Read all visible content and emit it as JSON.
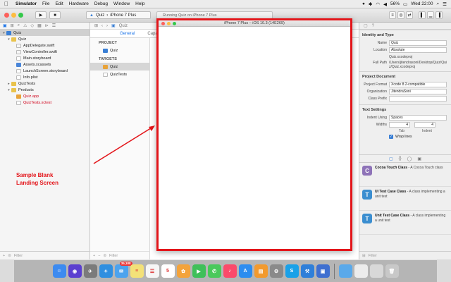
{
  "menubar": {
    "app": "Simulator",
    "items": [
      "File",
      "Edit",
      "Hardware",
      "Debug",
      "Window",
      "Help"
    ],
    "battery": "56%",
    "clock": "Wed 22:00"
  },
  "toolbar": {
    "scheme_target": "Quiz",
    "scheme_device": "iPhone 7 Plus",
    "activity_text": "Running Quiz on iPhone 7 Plus"
  },
  "navigator": {
    "rows": [
      {
        "label": "Quiz",
        "icon": "proj",
        "depth": 0,
        "disclosure": "▾",
        "selected": true,
        "red": false
      },
      {
        "label": "Quiz",
        "icon": "folder",
        "depth": 1,
        "disclosure": "▾",
        "selected": false,
        "red": false
      },
      {
        "label": "AppDelegate.swift",
        "icon": "swift",
        "depth": 2,
        "disclosure": "",
        "selected": false,
        "red": false
      },
      {
        "label": "ViewController.swift",
        "icon": "swift",
        "depth": 2,
        "disclosure": "",
        "selected": false,
        "red": false
      },
      {
        "label": "Main.storyboard",
        "icon": "story",
        "depth": 2,
        "disclosure": "",
        "selected": false,
        "red": false
      },
      {
        "label": "Assets.xcassets",
        "icon": "assets",
        "depth": 2,
        "disclosure": "",
        "selected": false,
        "red": false
      },
      {
        "label": "LaunchScreen.storyboard",
        "icon": "story",
        "depth": 2,
        "disclosure": "",
        "selected": false,
        "red": false
      },
      {
        "label": "Info.plist",
        "icon": "plist",
        "depth": 2,
        "disclosure": "",
        "selected": false,
        "red": false
      },
      {
        "label": "QuizTests",
        "icon": "folder",
        "depth": 1,
        "disclosure": "▸",
        "selected": false,
        "red": false
      },
      {
        "label": "Products",
        "icon": "folder",
        "depth": 1,
        "disclosure": "▾",
        "selected": false,
        "red": false
      },
      {
        "label": "Quiz.app",
        "icon": "app",
        "depth": 2,
        "disclosure": "",
        "selected": false,
        "red": true
      },
      {
        "label": "QuizTests.xctest",
        "icon": "plist",
        "depth": 2,
        "disclosure": "",
        "selected": false,
        "red": true
      }
    ],
    "filter_placeholder": "Filter"
  },
  "editor": {
    "breadcrumb": "Quiz",
    "tabs": [
      "General",
      "Capa"
    ],
    "project_header": "PROJECT",
    "project_item": "Quiz",
    "targets_header": "TARGETS",
    "targets": [
      "Quiz",
      "QuizTests"
    ],
    "filter_placeholder": "Filter"
  },
  "simulator": {
    "title": "iPhone 7 Plus – iOS 10.3 (14E269)"
  },
  "annotation": {
    "text": "Sample Blank Landing Screen"
  },
  "inspector": {
    "identity": {
      "title": "Identity and Type",
      "name_label": "Name",
      "name_value": "Quiz",
      "location_label": "Location",
      "location_value": "Absolute",
      "file_value": "Quiz.xcodeproj",
      "full_path_label": "Full Path",
      "full_path_value": "/Users/jitendrasoni/Desktop/Quiz/Quiz/Quiz.xcodeproj"
    },
    "project_document": {
      "title": "Project Document",
      "format_label": "Project Format",
      "format_value": "Xcode 8.2-compatible",
      "org_label": "Organization",
      "org_value": "JitendraSoni",
      "prefix_label": "Class Prefix",
      "prefix_value": ""
    },
    "text_settings": {
      "title": "Text Settings",
      "indent_label": "Indent Using",
      "indent_value": "Spaces",
      "widths_label": "Widths",
      "tab_value": "4",
      "indent_width_value": "4",
      "tab_caption": "Tab",
      "indent_caption": "Indent",
      "wrap_label": "Wrap lines"
    },
    "library": [
      {
        "title": "Cocoa Touch Class",
        "desc": " - A Cocoa Touch class",
        "icon_letter": "C",
        "color": "#8e73b8"
      },
      {
        "title": "UI Test Case Class",
        "desc": " - A class implementing a unit test",
        "icon_letter": "T",
        "color": "#3b8ed0"
      },
      {
        "title": "Unit Test Case Class",
        "desc": " - A class implementing a unit test",
        "icon_letter": "T",
        "color": "#3b8ed0"
      }
    ],
    "filter_placeholder": "Filter"
  },
  "dock": {
    "icons": [
      {
        "name": "finder-icon",
        "color": "#3d8bf0",
        "glyph": "☺"
      },
      {
        "name": "siri-icon",
        "color": "#5b3fd0",
        "glyph": "◉"
      },
      {
        "name": "launchpad-icon",
        "color": "#7b7b7b",
        "glyph": "✈"
      },
      {
        "name": "safari-icon",
        "color": "#2f8fe0",
        "glyph": "✧"
      },
      {
        "name": "mail-icon",
        "color": "#4ca3ee",
        "glyph": "✉"
      },
      {
        "name": "notes-icon",
        "color": "#f3e178",
        "glyph": "≡"
      },
      {
        "name": "reminders-icon",
        "color": "#f6f6f6",
        "glyph": "☰"
      },
      {
        "name": "calendar-icon",
        "color": "#ffffff",
        "glyph": "5"
      },
      {
        "name": "photos-icon",
        "color": "#f3a33b",
        "glyph": "✿"
      },
      {
        "name": "facetime-icon",
        "color": "#3fc05a",
        "glyph": "▶"
      },
      {
        "name": "messages-icon",
        "color": "#49c95b",
        "glyph": "✆"
      },
      {
        "name": "music-icon",
        "color": "#fb4a6b",
        "glyph": "♪"
      },
      {
        "name": "appstore-icon",
        "color": "#2c8df0",
        "glyph": "A"
      },
      {
        "name": "ibooks-icon",
        "color": "#f29a2e",
        "glyph": "▤"
      },
      {
        "name": "preferences-icon",
        "color": "#8a8a8a",
        "glyph": "⚙"
      },
      {
        "name": "skype-icon",
        "color": "#1aa1e8",
        "glyph": "S"
      },
      {
        "name": "xcode-icon",
        "color": "#2f7fd9",
        "glyph": "⚒"
      },
      {
        "name": "simulator-icon",
        "color": "#3f6fd0",
        "glyph": "▣"
      },
      {
        "name": "folder-icon",
        "color": "#5aa9ea",
        "glyph": ""
      },
      {
        "name": "document-icon",
        "color": "#ececec",
        "glyph": ""
      },
      {
        "name": "image-icon",
        "color": "#d8d8d8",
        "glyph": ""
      },
      {
        "name": "trash-icon",
        "color": "#c8c8c8",
        "glyph": "🗑"
      }
    ],
    "badge": "35,188"
  },
  "colors": {
    "annotation_red": "#e3151a",
    "accent_blue": "#1a73e8"
  }
}
